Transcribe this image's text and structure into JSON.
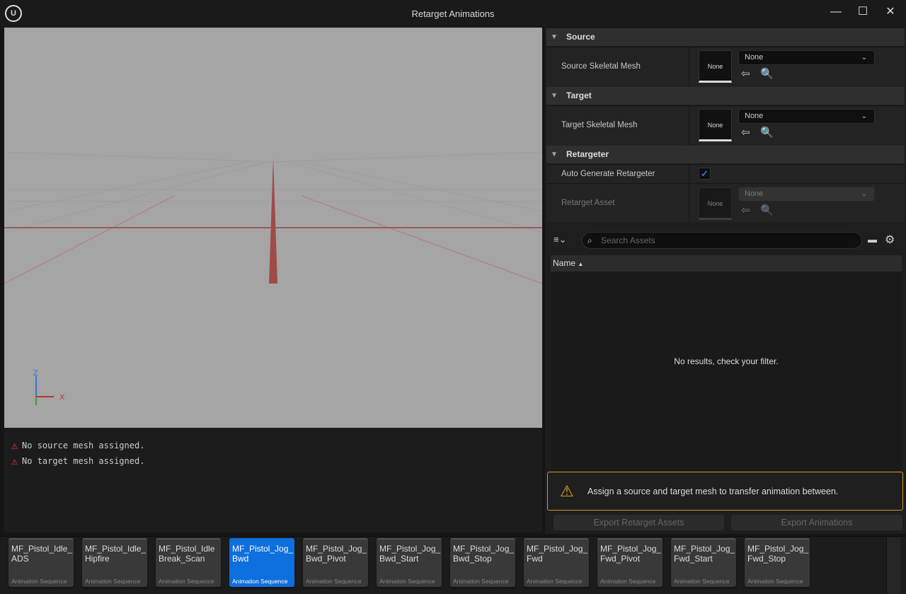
{
  "window": {
    "title": "Retarget Animations",
    "logo": "U",
    "minimize": "—",
    "maximize": "☐",
    "close": "✕"
  },
  "log": [
    "No source mesh assigned.",
    "No target mesh assigned."
  ],
  "viewport": {
    "axis_z": "Z",
    "axis_x": "X"
  },
  "details": {
    "source": {
      "header": "Source",
      "label": "Source Skeletal Mesh",
      "thumb": "None",
      "value": "None"
    },
    "target": {
      "header": "Target",
      "label": "Target Skeletal Mesh",
      "thumb": "None",
      "value": "None"
    },
    "retargeter": {
      "header": "Retargeter",
      "auto_label": "Auto Generate Retargeter",
      "auto_checked": true,
      "asset_label": "Retarget Asset",
      "thumb": "None",
      "value": "None"
    }
  },
  "assets": {
    "search_placeholder": "Search Assets",
    "column_name": "Name",
    "empty": "No results, check your filter."
  },
  "warning": "Assign a source and target mesh to transfer animation between.",
  "buttons": {
    "export_retarget": "Export Retarget Assets",
    "export_anims": "Export Animations"
  },
  "tiles": [
    {
      "name": "MF_Pistol_Idle_ADS",
      "type": "Animation Sequence"
    },
    {
      "name": "MF_Pistol_Idle_Hipfire",
      "type": "Animation Sequence"
    },
    {
      "name": "MF_Pistol_Idle Break_Scan",
      "type": "Animation Sequence"
    },
    {
      "name": "MF_Pistol_Jog_Bwd",
      "type": "Animation Sequence",
      "selected": true
    },
    {
      "name": "MF_Pistol_Jog_Bwd_Pivot",
      "type": "Animation Sequence"
    },
    {
      "name": "MF_Pistol_Jog_Bwd_Start",
      "type": "Animation Sequence"
    },
    {
      "name": "MF_Pistol_Jog_Bwd_Stop",
      "type": "Animation Sequence"
    },
    {
      "name": "MF_Pistol_Jog_Fwd",
      "type": "Animation Sequence"
    },
    {
      "name": "MF_Pistol_Jog_Fwd_Pivot",
      "type": "Animation Sequence"
    },
    {
      "name": "MF_Pistol_Jog_Fwd_Start",
      "type": "Animation Sequence"
    },
    {
      "name": "MF_Pistol_Jog_Fwd_Stop",
      "type": "Animation Sequence"
    }
  ]
}
